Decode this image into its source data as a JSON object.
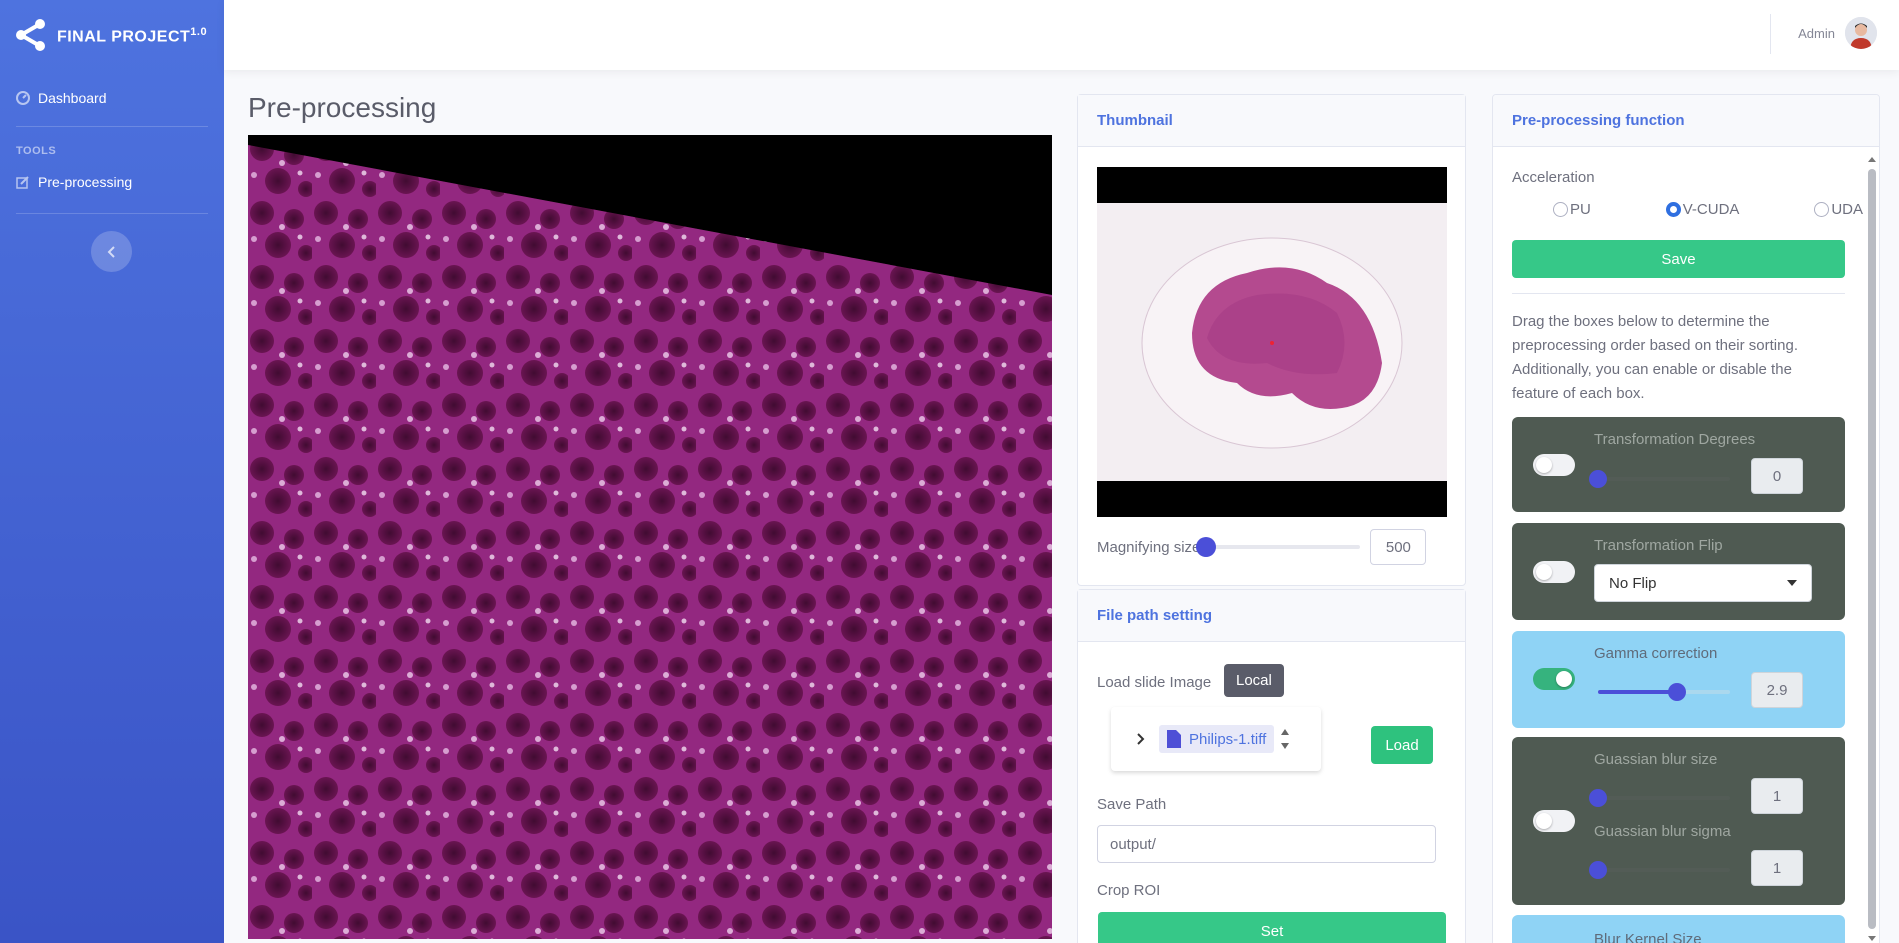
{
  "brand": {
    "name": "FINAL PROJECT",
    "version": "1.0"
  },
  "sidebar": {
    "dashboard_label": "Dashboard",
    "tools_heading": "TOOLS",
    "preprocessing_label": "Pre-processing"
  },
  "topbar": {
    "user_name": "Admin"
  },
  "page": {
    "title": "Pre-processing"
  },
  "thumbnail": {
    "title": "Thumbnail",
    "magnify_label": "Magnifying size",
    "magnify_value": "500",
    "magnify_fraction": 0.0
  },
  "file_path": {
    "title": "File path setting",
    "load_label": "Load slide Image",
    "local_button": "Local",
    "file_name": "Philips-1.tiff",
    "load_button": "Load",
    "save_path_label": "Save Path",
    "save_path_value": "output/",
    "crop_label": "Crop ROI",
    "set_button": "Set"
  },
  "preprocessing": {
    "title": "Pre-processing function",
    "acceleration_label": "Acceleration",
    "radio_cpu": "PU",
    "radio_cv_cuda": "V-CUDA",
    "radio_cuda": "UDA",
    "selected": "CV-CUDA",
    "save_button": "Save",
    "hint": "Drag the boxes below to determine the preprocessing order based on their sorting. Additionally, you can enable or disable the feature of each box.",
    "boxes": {
      "degrees": {
        "label": "Transformation Degrees",
        "value": "0",
        "enabled": false,
        "fraction": 0.0
      },
      "flip": {
        "label": "Transformation Flip",
        "value": "No Flip",
        "enabled": false
      },
      "gamma": {
        "label": "Gamma correction",
        "value": "2.9",
        "enabled": true,
        "fraction": 0.6
      },
      "blur": {
        "size_label": "Guassian blur size",
        "size_value": "1",
        "size_fraction": 0.0,
        "sigma_label": "Guassian blur sigma",
        "sigma_value": "1",
        "sigma_fraction": 0.0,
        "enabled": false
      },
      "kernel": {
        "label": "Blur Kernel Size"
      }
    }
  }
}
